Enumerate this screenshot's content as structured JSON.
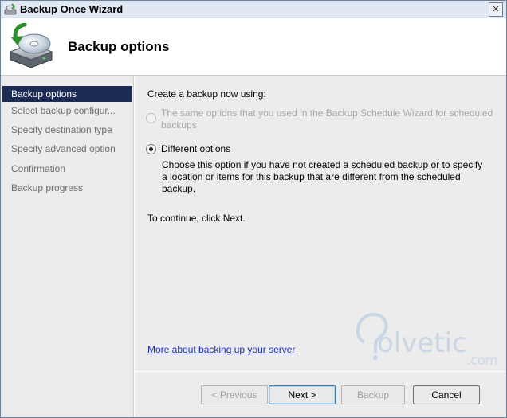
{
  "window": {
    "title": "Backup Once Wizard",
    "close_glyph": "✕"
  },
  "header": {
    "title": "Backup options",
    "icon": "backup-disk-icon"
  },
  "sidebar": {
    "items": [
      {
        "label": "Backup options",
        "active": true
      },
      {
        "label": "Select backup configur..."
      },
      {
        "label": "Specify destination type"
      },
      {
        "label": "Specify advanced option"
      },
      {
        "label": "Confirmation"
      },
      {
        "label": "Backup progress"
      }
    ]
  },
  "main": {
    "prompt": "Create a backup now using:",
    "options": [
      {
        "label_line1": "The same options that you used in the Backup Schedule Wizard for scheduled",
        "label_line2": "backups",
        "enabled": false,
        "selected": false
      },
      {
        "label": "Different options",
        "enabled": true,
        "selected": true,
        "description_line1": "Choose this option if you have not created a scheduled backup or to specify",
        "description_line2": "a location or items for this backup that are different from the scheduled",
        "description_line3": "backup."
      }
    ],
    "continue_text": "To continue, click Next.",
    "help_link": "More about backing up your server"
  },
  "watermark": {
    "text": "olvetic",
    "suffix": ".com"
  },
  "buttons": {
    "previous": "< Previous",
    "next": "Next >",
    "backup": "Backup",
    "cancel": "Cancel"
  },
  "colors": {
    "nav_active_bg": "#1d2c55",
    "link": "#1c2fbf",
    "panel_bg": "#ececec"
  }
}
